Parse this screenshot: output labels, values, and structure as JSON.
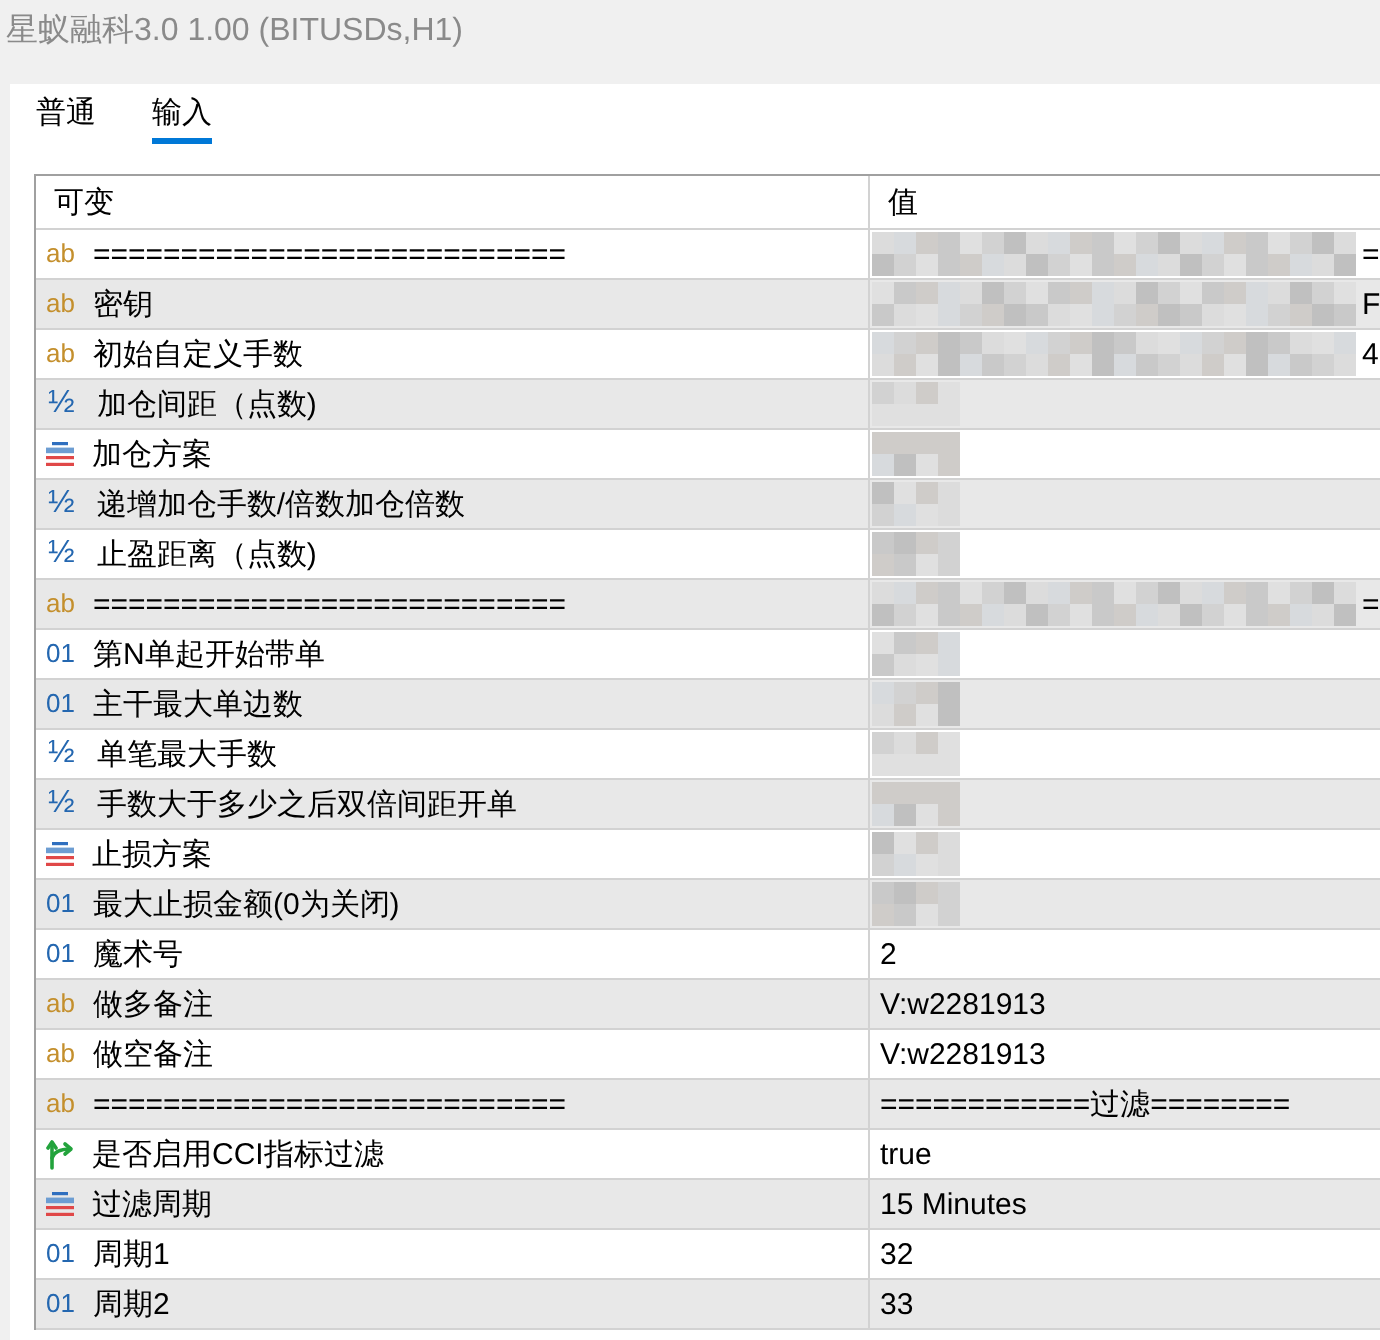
{
  "window": {
    "title": "星蚁融科3.0 1.00 (BITUSDs,H1)"
  },
  "tabs": [
    {
      "label": "普通",
      "selected": false
    },
    {
      "label": "输入",
      "selected": true
    }
  ],
  "table": {
    "columns": [
      "可变",
      "值"
    ],
    "rows": [
      {
        "kind": "string",
        "type_icon": "ab",
        "name": "===========================",
        "masked": true,
        "value_tail": "="
      },
      {
        "kind": "string",
        "type_icon": "ab",
        "name": "密钥",
        "masked": true,
        "value_tail": "F"
      },
      {
        "kind": "string",
        "type_icon": "ab",
        "name": "初始自定义手数",
        "masked": true,
        "value_tail": "4"
      },
      {
        "kind": "double",
        "type_icon": "½",
        "name": "加仓间距（点数)",
        "masked": true
      },
      {
        "kind": "enum",
        "name": "加仓方案",
        "masked": true
      },
      {
        "kind": "double",
        "type_icon": "½",
        "name": "递增加仓手数/倍数加仓倍数",
        "masked": true
      },
      {
        "kind": "double",
        "type_icon": "½",
        "name": "止盈距离（点数)",
        "masked": true
      },
      {
        "kind": "string",
        "type_icon": "ab",
        "name": "===========================",
        "masked": true,
        "value_tail": "="
      },
      {
        "kind": "integer",
        "type_icon": "01",
        "name": "第N单起开始带单",
        "masked": true
      },
      {
        "kind": "integer",
        "type_icon": "01",
        "name": "主干最大单边数",
        "masked": true
      },
      {
        "kind": "double",
        "type_icon": "½",
        "name": "单笔最大手数",
        "masked": true
      },
      {
        "kind": "double",
        "type_icon": "½",
        "name": "手数大于多少之后双倍间距开单",
        "masked": true
      },
      {
        "kind": "enum",
        "name": "止损方案",
        "masked": true
      },
      {
        "kind": "integer",
        "type_icon": "01",
        "name": "最大止损金额(0为关闭)",
        "masked": true
      },
      {
        "kind": "integer",
        "type_icon": "01",
        "name": "魔术号",
        "masked": false,
        "value": "2"
      },
      {
        "kind": "string",
        "type_icon": "ab",
        "name": "做多备注",
        "masked": false,
        "value": "V:w2281913"
      },
      {
        "kind": "string",
        "type_icon": "ab",
        "name": "做空备注",
        "masked": false,
        "value": "V:w2281913"
      },
      {
        "kind": "string",
        "type_icon": "ab",
        "name": "===========================",
        "masked": false,
        "value": "============过滤========"
      },
      {
        "kind": "bool",
        "name": "是否启用CCI指标过滤",
        "masked": false,
        "value": "true"
      },
      {
        "kind": "enum",
        "name": "过滤周期",
        "masked": false,
        "value": "15 Minutes"
      },
      {
        "kind": "integer",
        "type_icon": "01",
        "name": "周期1",
        "masked": false,
        "value": "32"
      },
      {
        "kind": "integer",
        "type_icon": "01",
        "name": "周期2",
        "masked": false,
        "value": "33"
      }
    ]
  }
}
